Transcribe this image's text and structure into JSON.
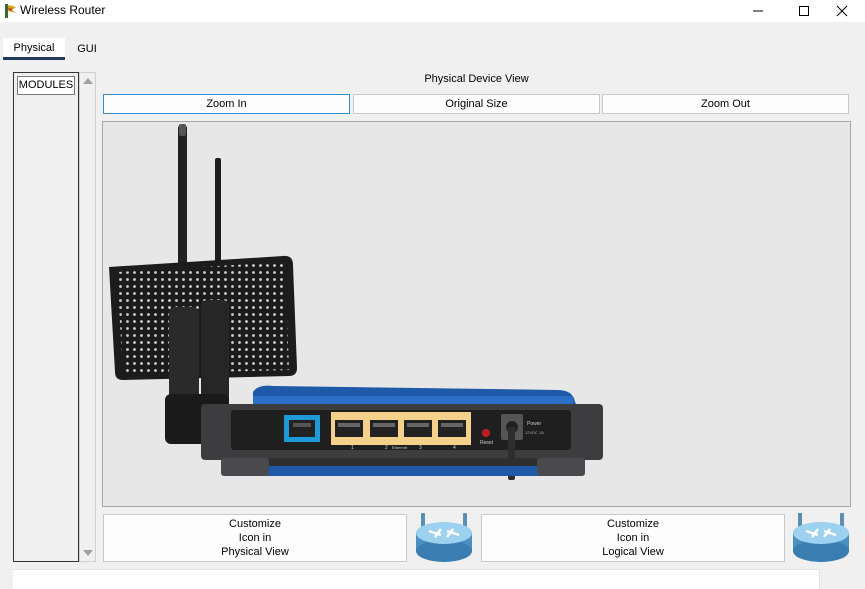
{
  "window": {
    "title": "Wireless Router"
  },
  "tabs": [
    {
      "label": "Physical",
      "active": true
    },
    {
      "label": "GUI",
      "active": false
    }
  ],
  "modules": {
    "label": "MODULES"
  },
  "view": {
    "title": "Physical Device View",
    "zoom_in": "Zoom In",
    "original_size": "Original Size",
    "zoom_out": "Zoom Out"
  },
  "customize": {
    "physical": {
      "line1": "Customize",
      "line2": "Icon in",
      "line3": "Physical View"
    },
    "logical": {
      "line1": "Customize",
      "line2": "Icon in",
      "line3": "Logical View"
    }
  },
  "router_panel": {
    "port_labels": [
      "1",
      "2",
      "3",
      "4"
    ],
    "ethernet_label": "Ethernet",
    "reset_label": "Reset",
    "power_label": "Power",
    "power_rating": "12VDC 1A"
  },
  "colors": {
    "accent": "#1f3a5a",
    "router_blue": "#1e5aa8",
    "wan_port": "#1e9ad6",
    "lan_ports": "#f3d18a"
  },
  "icons": {
    "app": "router-app-icon",
    "minimize": "minimize-icon",
    "maximize": "maximize-icon",
    "close": "close-icon",
    "router": "router-icon"
  }
}
